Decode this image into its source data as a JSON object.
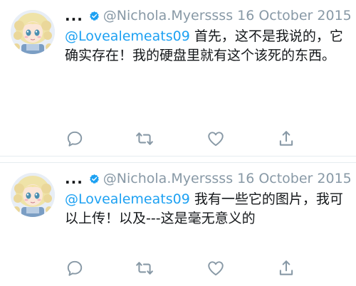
{
  "colors": {
    "accent": "#1da1f2",
    "muted": "#8899a6",
    "text": "#14171a",
    "divider": "#e6ecf0"
  },
  "tweets": [
    {
      "name": "...",
      "handle": "@Nichola.Myerssss",
      "date": "16 October 2015",
      "mention": "@Lovealemeats09",
      "text": " 首先，这不是我说的，它确实存在！我的硬盘里就有这个该死的东西。",
      "icons": [
        "verified-icon",
        "chevron-down-icon",
        "reply-icon",
        "retweet-icon",
        "like-icon",
        "share-icon"
      ]
    },
    {
      "name": "...",
      "handle": "@Nichola.Myerssss",
      "date": "16 October 2015",
      "mention": "@Lovealemeats09",
      "text": " 我有一些它的图片，我可以上传！以及---这是毫无意义的",
      "icons": [
        "verified-icon",
        "chevron-down-icon",
        "reply-icon",
        "retweet-icon",
        "like-icon",
        "share-icon"
      ]
    }
  ]
}
